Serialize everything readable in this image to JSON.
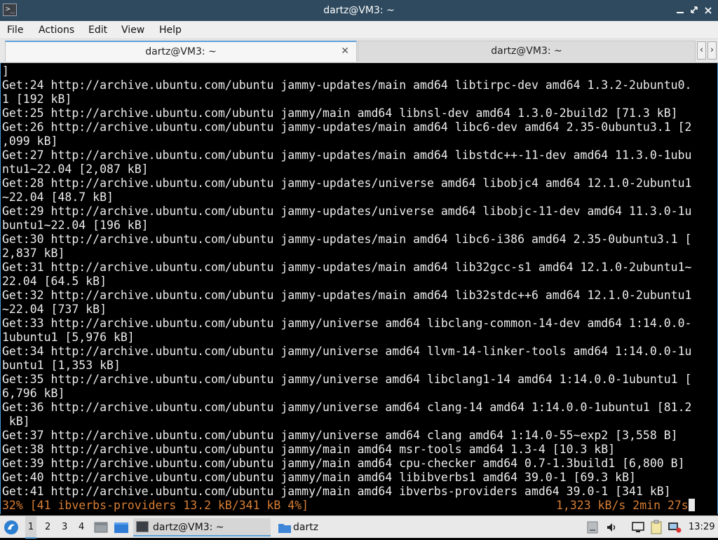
{
  "window": {
    "title": "dartz@VM3: ~",
    "icons": {
      "app": "terminal-icon",
      "minimize": "minimize-icon",
      "maximize": "restore-icon",
      "close": "close-icon"
    }
  },
  "menu": [
    "File",
    "Actions",
    "Edit",
    "View",
    "Help"
  ],
  "tabs": [
    {
      "label": "dartz@VM3: ~",
      "active": true
    },
    {
      "label": "dartz@VM3: ~",
      "active": false
    }
  ],
  "terminal": {
    "lines": [
      "]",
      "Get:24 http://archive.ubuntu.com/ubuntu jammy-updates/main amd64 libtirpc-dev amd64 1.3.2-2ubuntu0.",
      "1 [192 kB]",
      "Get:25 http://archive.ubuntu.com/ubuntu jammy/main amd64 libnsl-dev amd64 1.3.0-2build2 [71.3 kB]",
      "Get:26 http://archive.ubuntu.com/ubuntu jammy-updates/main amd64 libc6-dev amd64 2.35-0ubuntu3.1 [2",
      ",099 kB]",
      "Get:27 http://archive.ubuntu.com/ubuntu jammy-updates/main amd64 libstdc++-11-dev amd64 11.3.0-1ubu",
      "ntu1~22.04 [2,087 kB]",
      "Get:28 http://archive.ubuntu.com/ubuntu jammy-updates/universe amd64 libobjc4 amd64 12.1.0-2ubuntu1",
      "~22.04 [48.7 kB]",
      "Get:29 http://archive.ubuntu.com/ubuntu jammy-updates/universe amd64 libobjc-11-dev amd64 11.3.0-1u",
      "buntu1~22.04 [196 kB]",
      "Get:30 http://archive.ubuntu.com/ubuntu jammy-updates/main amd64 libc6-i386 amd64 2.35-0ubuntu3.1 [",
      "2,837 kB]",
      "Get:31 http://archive.ubuntu.com/ubuntu jammy-updates/main amd64 lib32gcc-s1 amd64 12.1.0-2ubuntu1~",
      "22.04 [64.5 kB]",
      "Get:32 http://archive.ubuntu.com/ubuntu jammy-updates/main amd64 lib32stdc++6 amd64 12.1.0-2ubuntu1",
      "~22.04 [737 kB]",
      "Get:33 http://archive.ubuntu.com/ubuntu jammy/universe amd64 libclang-common-14-dev amd64 1:14.0.0-",
      "1ubuntu1 [5,976 kB]",
      "Get:34 http://archive.ubuntu.com/ubuntu jammy/universe amd64 llvm-14-linker-tools amd64 1:14.0.0-1u",
      "buntu1 [1,353 kB]",
      "Get:35 http://archive.ubuntu.com/ubuntu jammy/universe amd64 libclang1-14 amd64 1:14.0.0-1ubuntu1 [",
      "6,796 kB]",
      "Get:36 http://archive.ubuntu.com/ubuntu jammy/universe amd64 clang-14 amd64 1:14.0.0-1ubuntu1 [81.2",
      " kB]",
      "Get:37 http://archive.ubuntu.com/ubuntu jammy/universe amd64 clang amd64 1:14.0-55~exp2 [3,558 B]",
      "Get:38 http://archive.ubuntu.com/ubuntu jammy/main amd64 msr-tools amd64 1.3-4 [10.3 kB]",
      "Get:39 http://archive.ubuntu.com/ubuntu jammy/main amd64 cpu-checker amd64 0.7-1.3build1 [6,800 B]",
      "Get:40 http://archive.ubuntu.com/ubuntu jammy/main amd64 libibverbs1 amd64 39.0-1 [69.3 kB]",
      "Get:41 http://archive.ubuntu.com/ubuntu jammy/main amd64 ibverbs-providers amd64 39.0-1 [341 kB]"
    ],
    "status_left": "32% [41 ibverbs-providers 13.2 kB/341 kB 4%]",
    "status_right": "1,323 kB/s 2min 27s",
    "colors": {
      "background": "#000000",
      "text": "#ececec",
      "status": "#d77e34",
      "accent": "#4c9ad6"
    }
  },
  "taskbar": {
    "workspaces": [
      "1",
      "2",
      "3",
      "4"
    ],
    "tasks": [
      {
        "label": "dartz@VM3: ~",
        "icon": "terminal-icon"
      },
      {
        "label": "dartz",
        "icon": "folder-icon"
      }
    ],
    "tray_icons": [
      "storage-icon",
      "volume-icon",
      "display-icon",
      "clipboard-icon",
      "network-icon"
    ],
    "clock": "13:29"
  }
}
